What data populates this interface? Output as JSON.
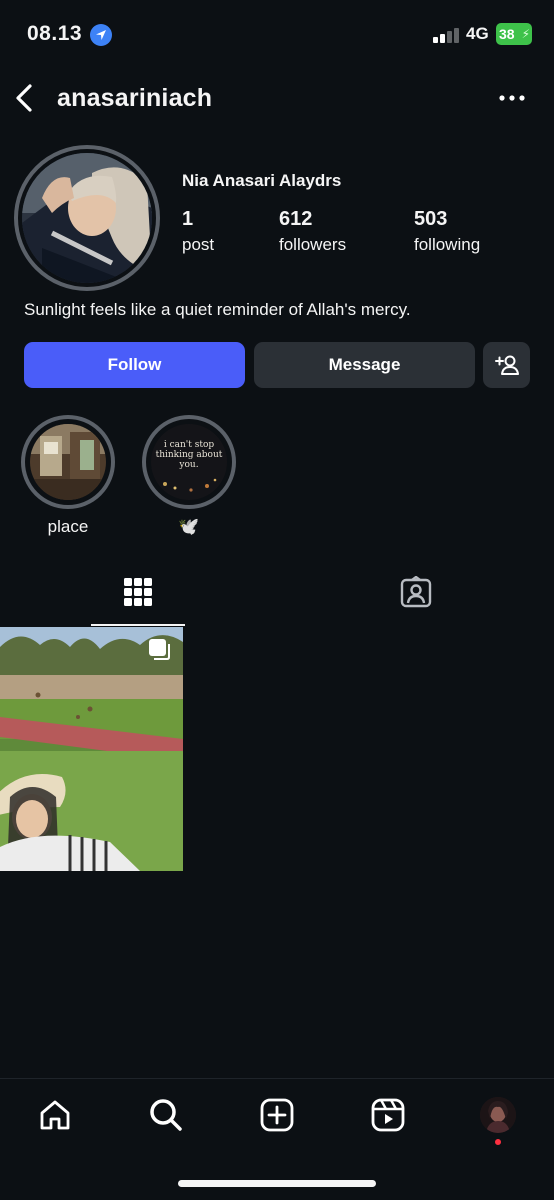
{
  "status_bar": {
    "time": "08.13",
    "location_icon": "location-arrow-icon",
    "network": "4G",
    "battery": "38"
  },
  "header": {
    "username": "anasariniach",
    "back_icon": "chevron-left-icon",
    "more_icon": "more-horizontal-icon"
  },
  "profile": {
    "display_name": "Nia Anasari Alaydrs",
    "stats": [
      {
        "value": "1",
        "label": "post"
      },
      {
        "value": "612",
        "label": "followers"
      },
      {
        "value": "503",
        "label": "following"
      }
    ],
    "bio": "Sunlight feels like a quiet reminder of Allah's mercy."
  },
  "actions": {
    "follow": "Follow",
    "message": "Message",
    "add_user_icon": "add-user-icon"
  },
  "highlights": [
    {
      "label": "place"
    },
    {
      "label": "🕊️",
      "cover_text": "i can't stop thinking about you."
    }
  ],
  "tabs": [
    {
      "name": "posts",
      "icon": "grid-icon",
      "active": true
    },
    {
      "name": "tagged",
      "icon": "tagged-person-icon",
      "active": false
    }
  ],
  "posts": [
    {
      "multi": true,
      "icon": "multiple-photos-icon"
    }
  ],
  "bottom_nav": [
    "home-icon",
    "search-icon",
    "create-icon",
    "reels-icon",
    "profile-avatar"
  ],
  "colors": {
    "background": "#0c1014",
    "follow_button": "#4a5df9",
    "secondary_button": "#2b3036",
    "battery": "#3ec24a",
    "notification_dot": "#ff3040"
  }
}
